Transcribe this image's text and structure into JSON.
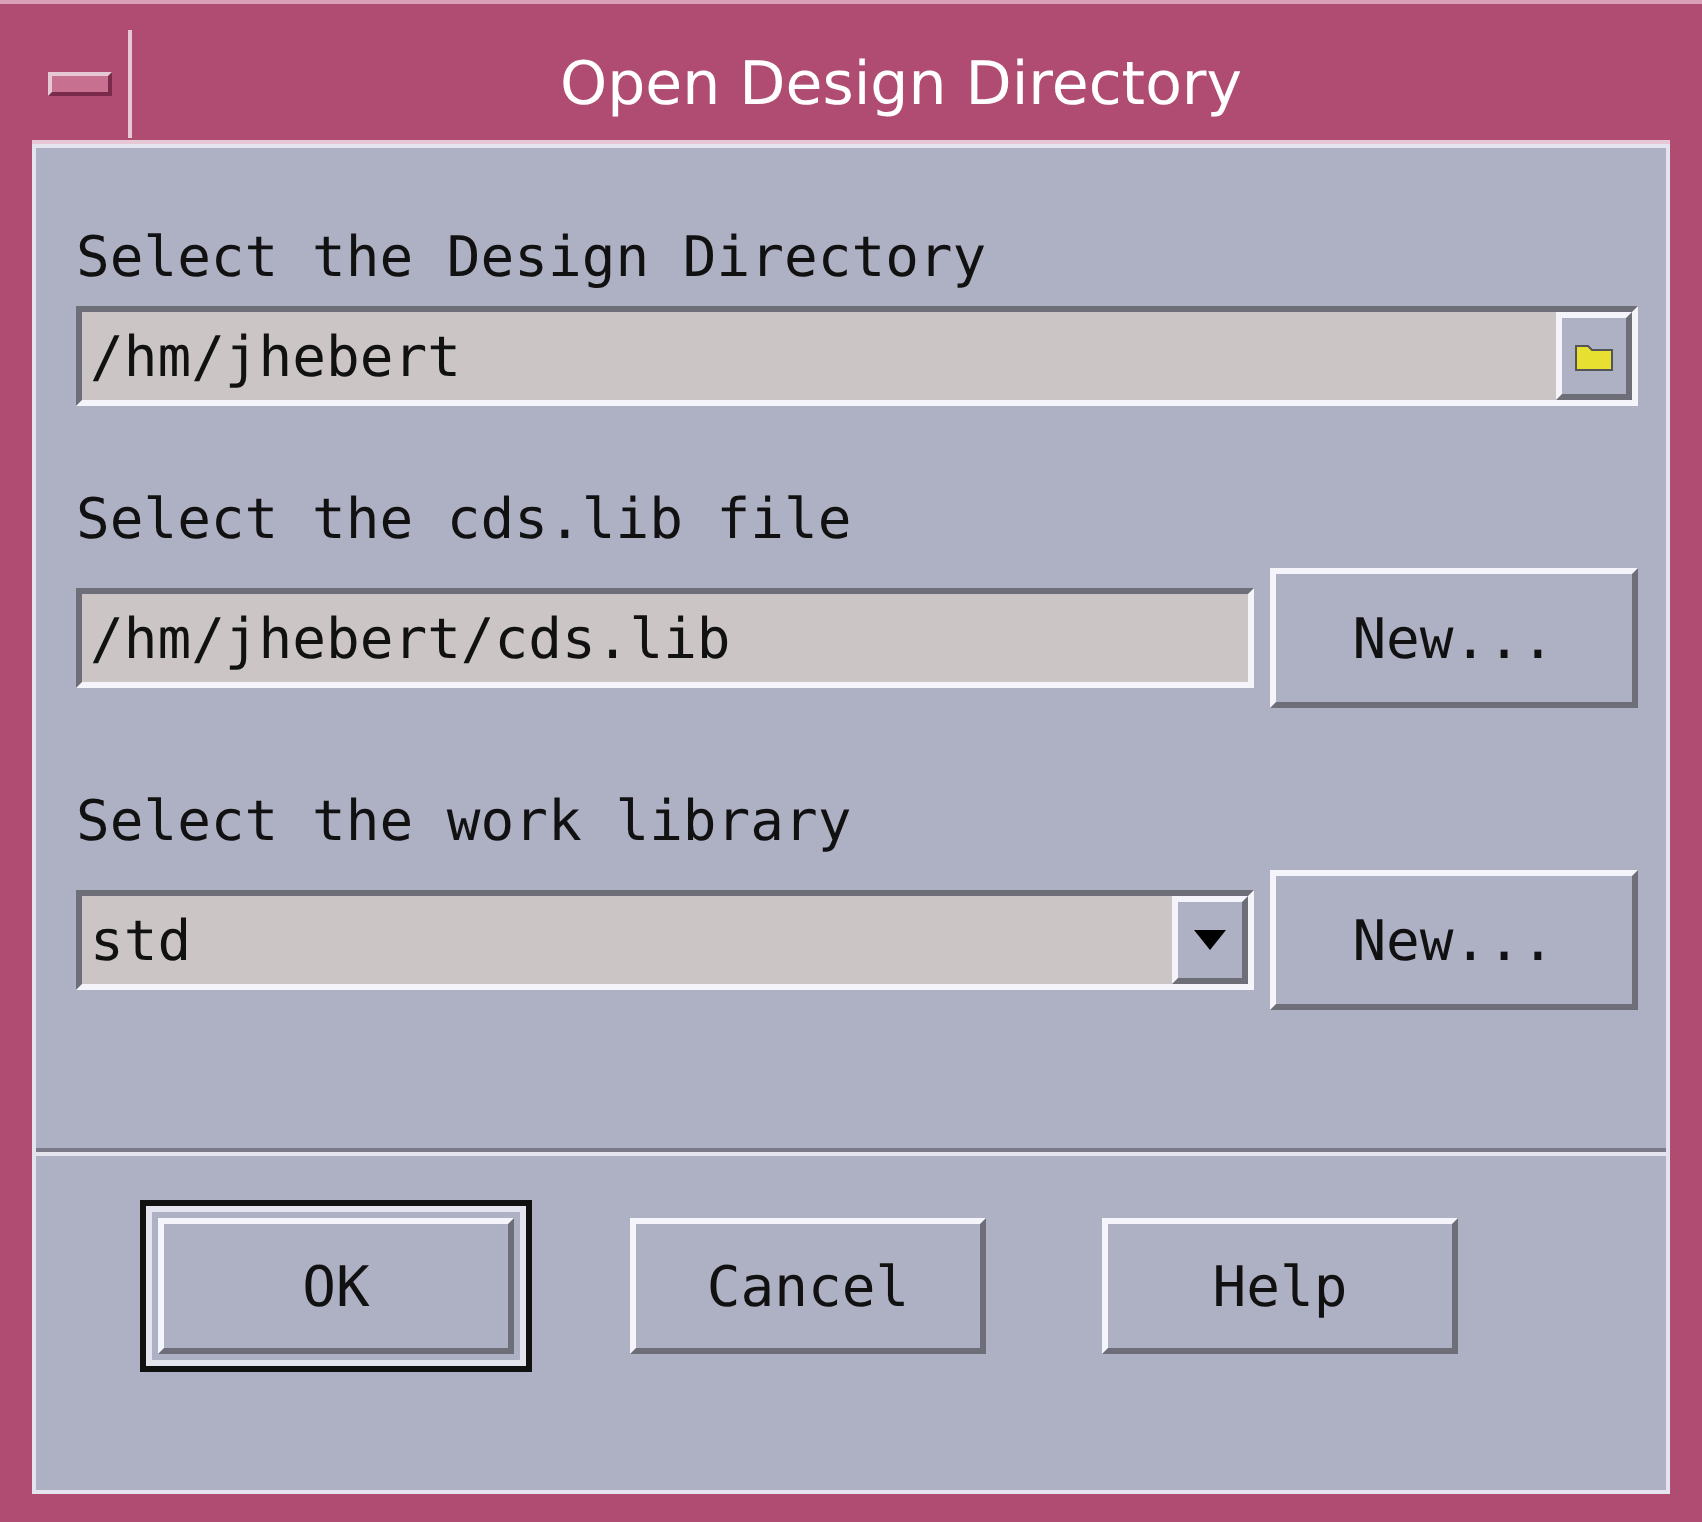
{
  "window": {
    "title": "Open Design Directory"
  },
  "fields": [
    {
      "kind": "browse",
      "label": "Select the Design Directory",
      "value": "/hm/jhebert"
    },
    {
      "kind": "text",
      "label": "Select the cds.lib file",
      "value": "/hm/jhebert/cds.lib",
      "button": "New..."
    },
    {
      "kind": "combo",
      "label": "Select the work library",
      "value": "std",
      "button": "New..."
    }
  ],
  "buttons": [
    {
      "label": "OK",
      "default": true
    },
    {
      "label": "Cancel",
      "default": false
    },
    {
      "label": "Help",
      "default": false
    }
  ]
}
